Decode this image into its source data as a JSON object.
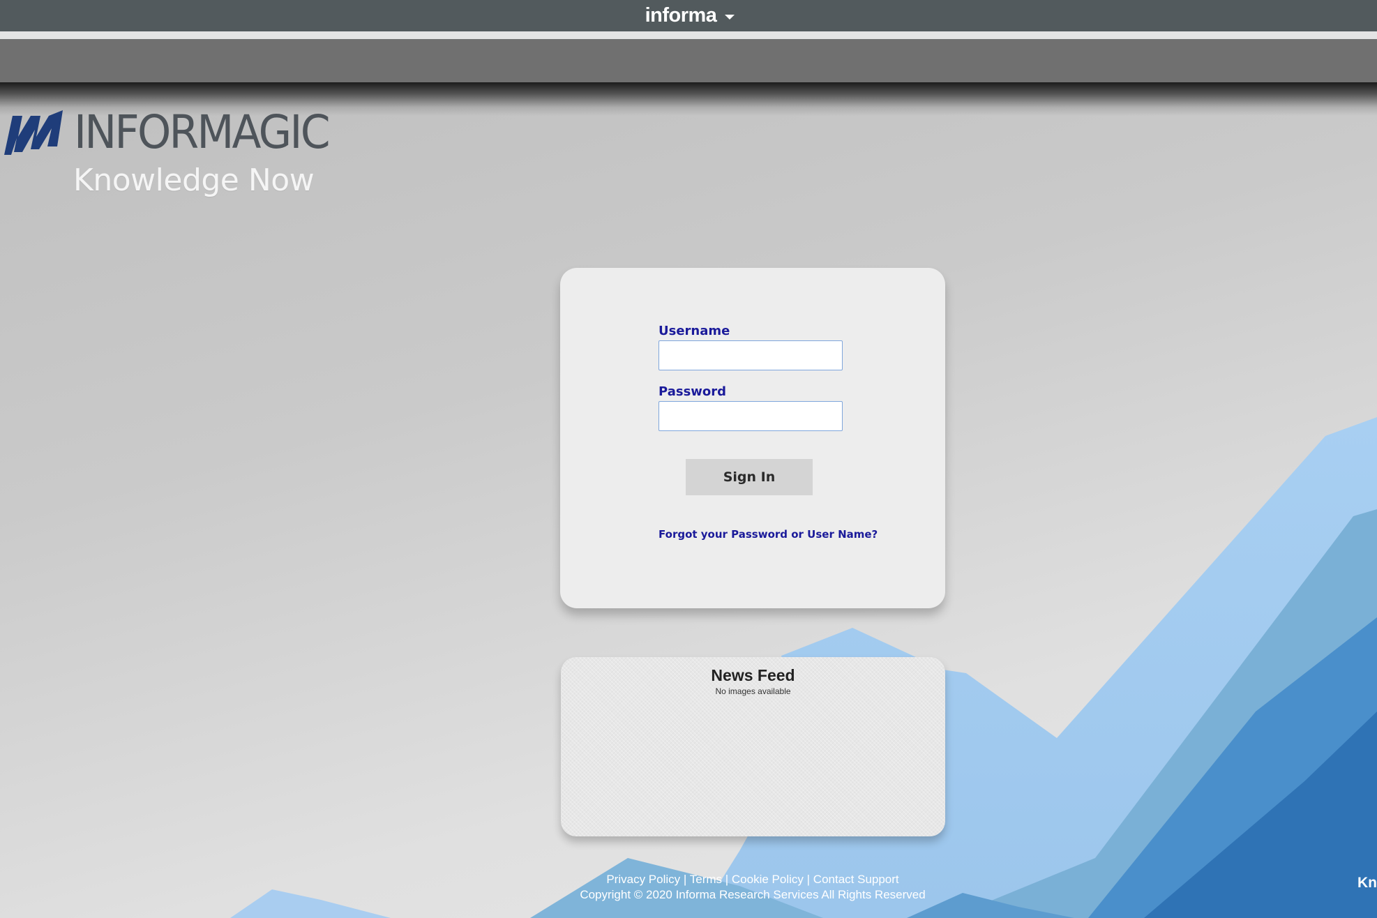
{
  "header": {
    "brand": "informa",
    "brand_menu_icon": "caret-down-icon"
  },
  "logo": {
    "wordmark": "INFORMAGIC",
    "tagline": "Knowledge Now",
    "mark_color": "#1f3d7a"
  },
  "login": {
    "username_label": "Username",
    "username_value": "",
    "password_label": "Password",
    "password_value": "",
    "signin_label": "Sign In",
    "forgot_label": "Forgot your Password or User Name?"
  },
  "news_feed": {
    "title": "News Feed",
    "empty_message": "No images available"
  },
  "footer": {
    "links": [
      "Privacy Policy",
      "Terms",
      "Cookie Policy",
      "Contact Support"
    ],
    "separator": "|",
    "copyright": "Copyright © 2020 Informa Research Services All Rights Reserved",
    "corner_text": "Kn"
  },
  "colors": {
    "top_bar": "#525a5d",
    "nav_bar": "#707070",
    "label_blue": "#1a1a9a",
    "mountain_light": "#a9cdf0",
    "mountain_mid": "#7fb3d8",
    "mountain_dark": "#3d7fc0"
  }
}
